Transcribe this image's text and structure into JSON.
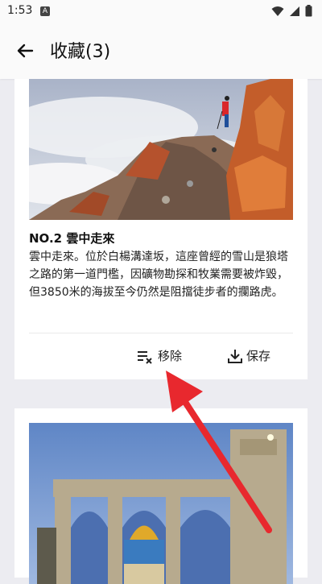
{
  "status": {
    "time": "1:53",
    "app_icon_letter": "A"
  },
  "header": {
    "title": "收藏(3)"
  },
  "cards": [
    {
      "title": "NO.2 雲中走來",
      "description": "雲中走來。位於白楊溝達坂，這座曾經的雪山是狼塔之路的第一道門檻，因礦物勘探和牧業需要被炸毀，但3850米的海拔至今仍然是阻擋徒步者的攔路虎。",
      "remove_label": "移除",
      "save_label": "保存"
    }
  ],
  "colors": {
    "accent_arrow": "#e8282e",
    "background": "#ececf1"
  }
}
